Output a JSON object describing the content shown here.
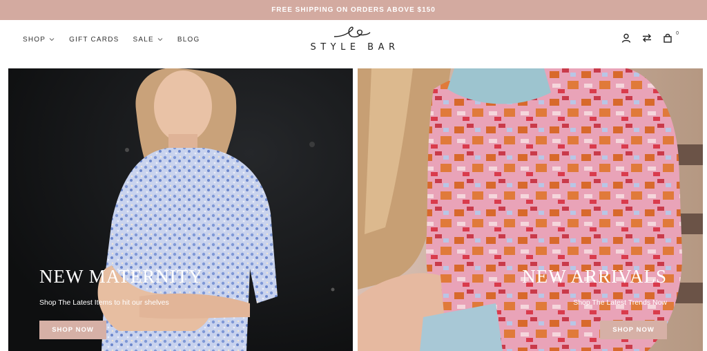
{
  "announcement": {
    "text": "FREE SHIPPING ON ORDERS ABOVE $150"
  },
  "nav": {
    "items": [
      {
        "label": "SHOP",
        "has_dropdown": true
      },
      {
        "label": "GIFT CARDS",
        "has_dropdown": false
      },
      {
        "label": "SALE",
        "has_dropdown": true
      },
      {
        "label": "BLOG",
        "has_dropdown": false
      }
    ]
  },
  "logo": {
    "text": "STYLE BAR"
  },
  "header_icons": {
    "account": "user-icon",
    "compare": "swap-arrows-icon",
    "cart": "shopping-bag-icon",
    "cart_count": "0"
  },
  "heroes": [
    {
      "title": "NEW MATERNITY",
      "subtitle": "Shop The Latest Items to hit our shelves",
      "button": "SHOP NOW"
    },
    {
      "title": "NEW ARRIVALS",
      "subtitle": "Shop The Latest Trends Now",
      "button": "SHOP NOW"
    }
  ],
  "colors": {
    "accent": "#d3aaa0",
    "button": "#d6b0a6",
    "left_hero_bg": "#141516",
    "sweater_pink": "#e79ab0",
    "sweater_orange": "#d8692c",
    "dress_blue": "#8ea6d8"
  }
}
